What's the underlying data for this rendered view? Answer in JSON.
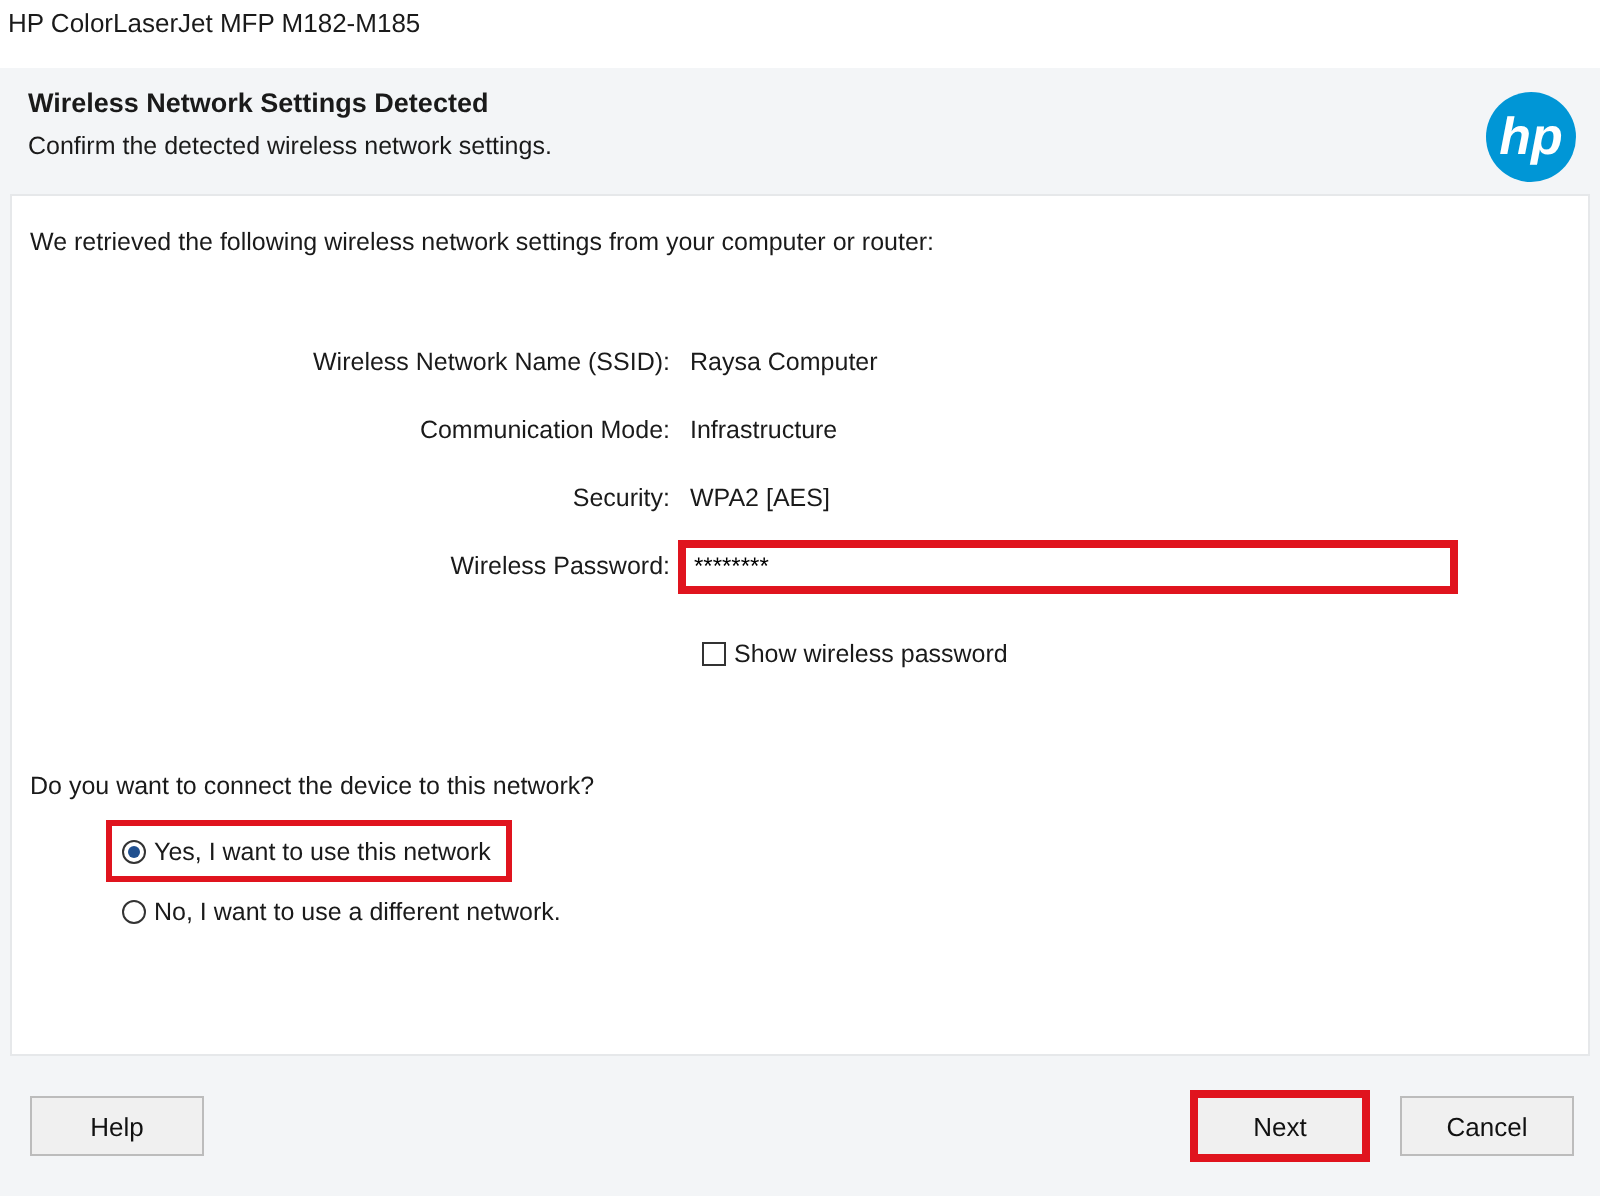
{
  "window": {
    "title": "HP ColorLaserJet MFP M182-M185"
  },
  "header": {
    "title": "Wireless Network Settings Detected",
    "subtitle": "Confirm the detected wireless network settings.",
    "logo": "hp"
  },
  "intro": "We retrieved the following wireless network settings from your computer or router:",
  "settings": [
    {
      "label": "Wireless Network Name (SSID):",
      "value": "Raysa Computer",
      "kind": "text"
    },
    {
      "label": "Communication Mode:",
      "value": "Infrastructure",
      "kind": "text"
    },
    {
      "label": "Security:",
      "value": "WPA2 [AES]",
      "kind": "text"
    },
    {
      "label": "Wireless Password:",
      "value": "********",
      "kind": "field",
      "highlighted": true
    }
  ],
  "show_password": {
    "label": "Show wireless password",
    "checked": false
  },
  "question": "Do you want to connect the device to this network?",
  "options": [
    {
      "label": "Yes, I want to use this network",
      "selected": true,
      "highlighted": true
    },
    {
      "label": "No, I want to use a different network.",
      "selected": false,
      "highlighted": false
    }
  ],
  "buttons": [
    {
      "label": "Help",
      "highlighted": false
    },
    {
      "label": "Next",
      "highlighted": true
    },
    {
      "label": "Cancel",
      "highlighted": false
    }
  ]
}
